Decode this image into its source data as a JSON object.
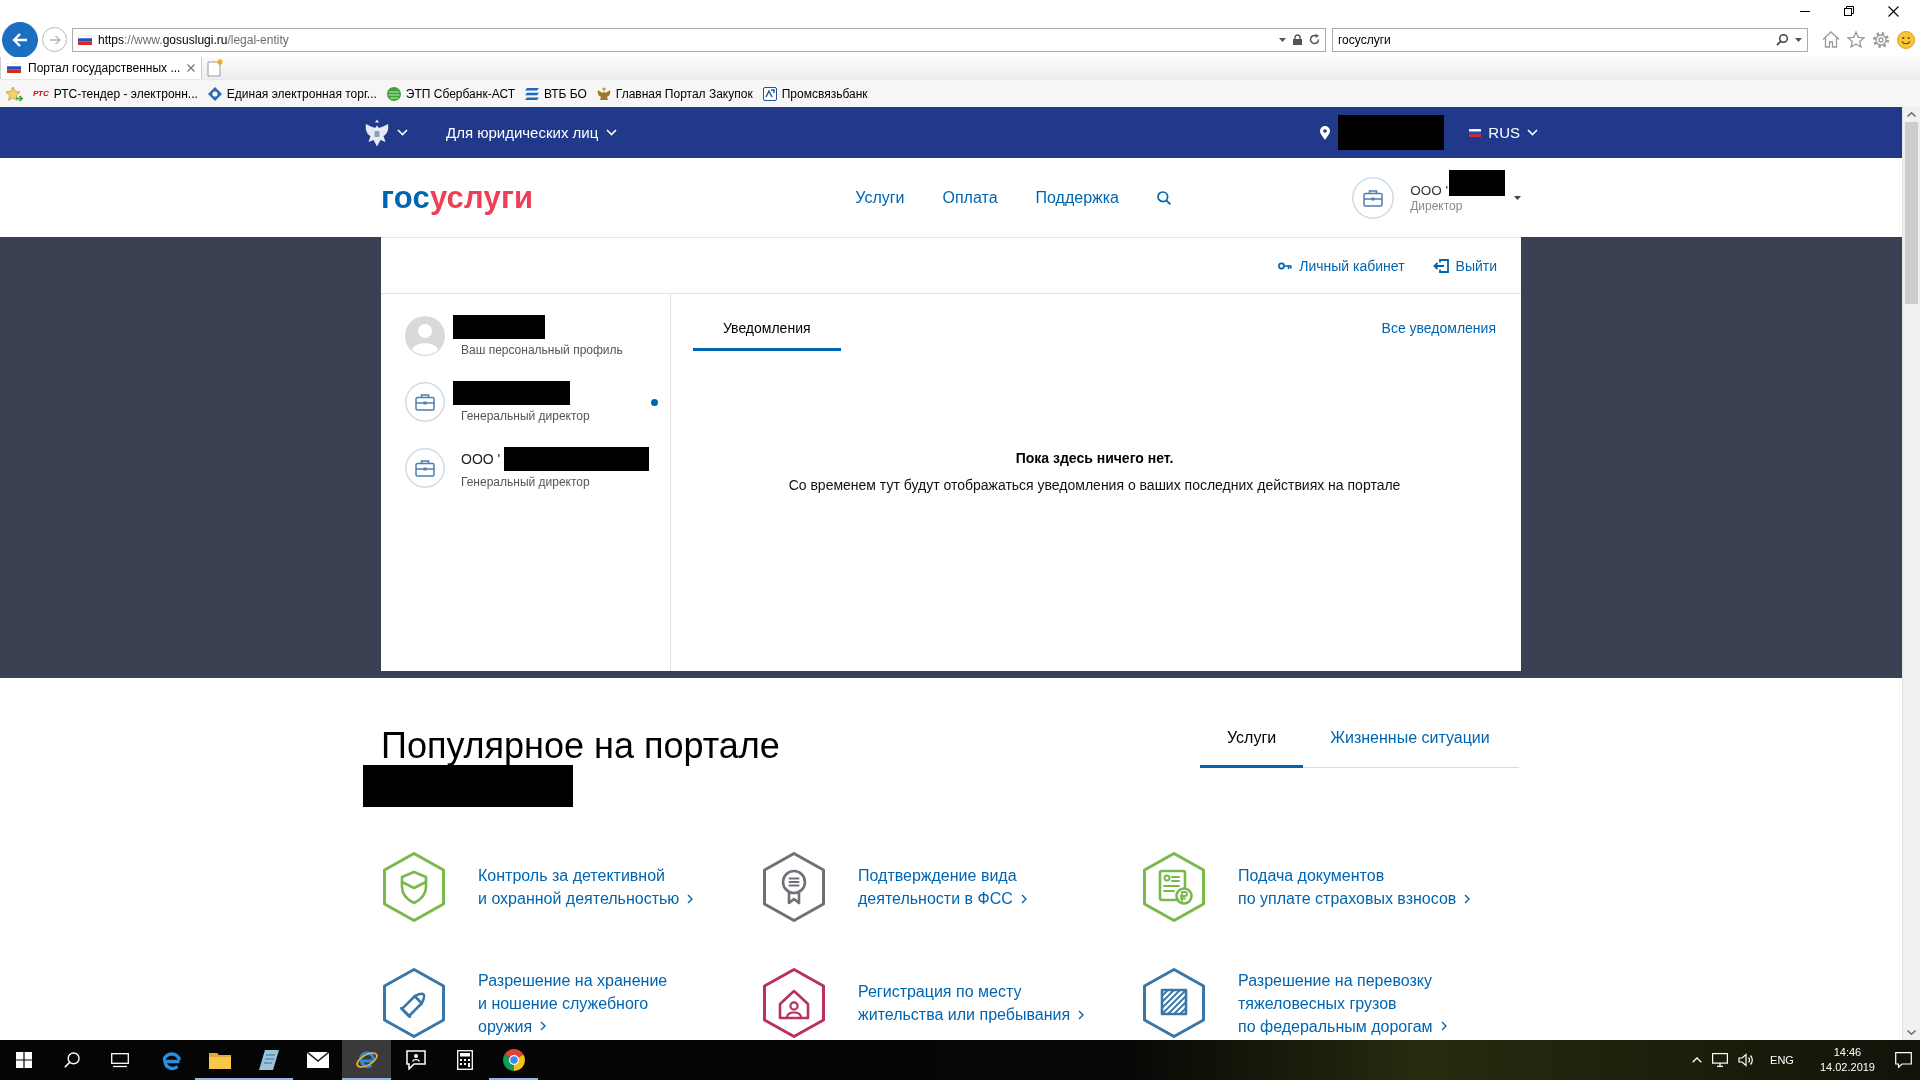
{
  "browser": {
    "nav_buttons": [
      {
        "kind": "back",
        "disabled": false
      },
      {
        "kind": "forward",
        "disabled": true
      }
    ],
    "url_parts": [
      {
        "text": "https",
        "strong": true
      },
      {
        "text": "://www.",
        "strong": false
      },
      {
        "text": "gosuslugi.ru",
        "strong": true
      },
      {
        "text": "/legal-entity",
        "strong": false
      }
    ],
    "search": {
      "value": "госуслуги"
    },
    "tabs": [
      {
        "title": "Портал государственных ...",
        "selected": true
      }
    ],
    "favorites": [
      {
        "kind": "text",
        "badge": "РТС",
        "label": "РТС-тендер - электронн..."
      },
      {
        "kind": "diamond",
        "label": "Единая электронная торг..."
      },
      {
        "kind": "ball",
        "label": "ЭТП Сбербанк-АСТ"
      },
      {
        "kind": "stripes",
        "label": "ВТБ БО"
      },
      {
        "kind": "emblem",
        "label": "Главная Портал Закупок"
      },
      {
        "kind": "square",
        "label": "Промсвязьбанк"
      }
    ]
  },
  "top_bar": {
    "section": "Для юридических лиц",
    "location_redacted": true,
    "language": "RUS"
  },
  "header": {
    "logo_parts": [
      {
        "text": "гос",
        "color": "#0065b1"
      },
      {
        "text": "услуги",
        "color": "#ee3f58"
      }
    ],
    "nav": [
      {
        "label": "Услуги"
      },
      {
        "label": "Оплата"
      },
      {
        "label": "Поддержка"
      }
    ],
    "account": {
      "name": "ООО '",
      "name_redacted": true,
      "role": "Директор"
    }
  },
  "profile_panel": {
    "links": [
      {
        "kind": "cabinet",
        "label": "Личный кабинет"
      },
      {
        "kind": "logout",
        "label": "Выйти"
      }
    ],
    "profiles": [
      {
        "kind": "person",
        "name_redacted": true,
        "role": "Ваш персональный профиль",
        "selected": false
      },
      {
        "kind": "organization",
        "name_redacted": true,
        "role": "Генеральный директор",
        "selected": true
      },
      {
        "kind": "organization",
        "name": "ООО '",
        "name_redacted": true,
        "role": "Генеральный директор",
        "selected": false
      }
    ],
    "tabs": [
      {
        "label": "Уведомления",
        "selected": true
      }
    ],
    "all_link": "Все уведомления",
    "empty_title": "Пока здесь ничего нет.",
    "empty_text": "Со временем тут будут отображаться уведомления о ваших последних действиях на портале"
  },
  "popular": {
    "title": "Популярное на портале",
    "subtitle_redacted": true,
    "tabs": [
      {
        "label": "Услуги",
        "selected": true
      },
      {
        "label": "Жизненные ситуации",
        "selected": false
      }
    ],
    "services": [
      {
        "kind": "shield",
        "color": "#79b84a",
        "lines": [
          "Контроль за детективной",
          "и охранной деятельностью"
        ]
      },
      {
        "kind": "award",
        "color": "#6e7178",
        "lines": [
          "Подтверждение вида",
          "деятельности в ФСС"
        ]
      },
      {
        "kind": "document",
        "color": "#79b84a",
        "lines": [
          "Подача документов",
          "по уплате страховых взносов"
        ]
      },
      {
        "kind": "bullet",
        "color": "#3977a8",
        "lines": [
          "Разрешение на хранение",
          "и ношение служебного",
          "оружия"
        ]
      },
      {
        "kind": "house",
        "color": "#b8325a",
        "lines": [
          "Регистрация по месту",
          "жительства или пребывания"
        ]
      },
      {
        "kind": "hatched",
        "color": "#3977a8",
        "lines": [
          "Разрешение на перевозку",
          "тяжеловесных грузов",
          "по федеральным дорогам"
        ]
      }
    ]
  },
  "taskbar": {
    "buttons": [
      {
        "kind": "start",
        "running": false,
        "selected": false
      },
      {
        "kind": "search",
        "running": false,
        "selected": false
      },
      {
        "kind": "task_view",
        "running": false,
        "selected": false
      },
      {
        "kind": "edge",
        "running": false,
        "selected": false
      },
      {
        "kind": "explorer",
        "running": true,
        "selected": false
      },
      {
        "kind": "notes",
        "running": true,
        "selected": false
      },
      {
        "kind": "mail",
        "running": false,
        "selected": false
      },
      {
        "kind": "ie",
        "running": true,
        "selected": true
      },
      {
        "kind": "feedback",
        "running": false,
        "selected": false
      },
      {
        "kind": "calculator",
        "running": false,
        "selected": false
      },
      {
        "kind": "chrome",
        "running": true,
        "selected": false
      }
    ],
    "language": "ENG",
    "time": "14:46",
    "date": "14.02.2019"
  }
}
